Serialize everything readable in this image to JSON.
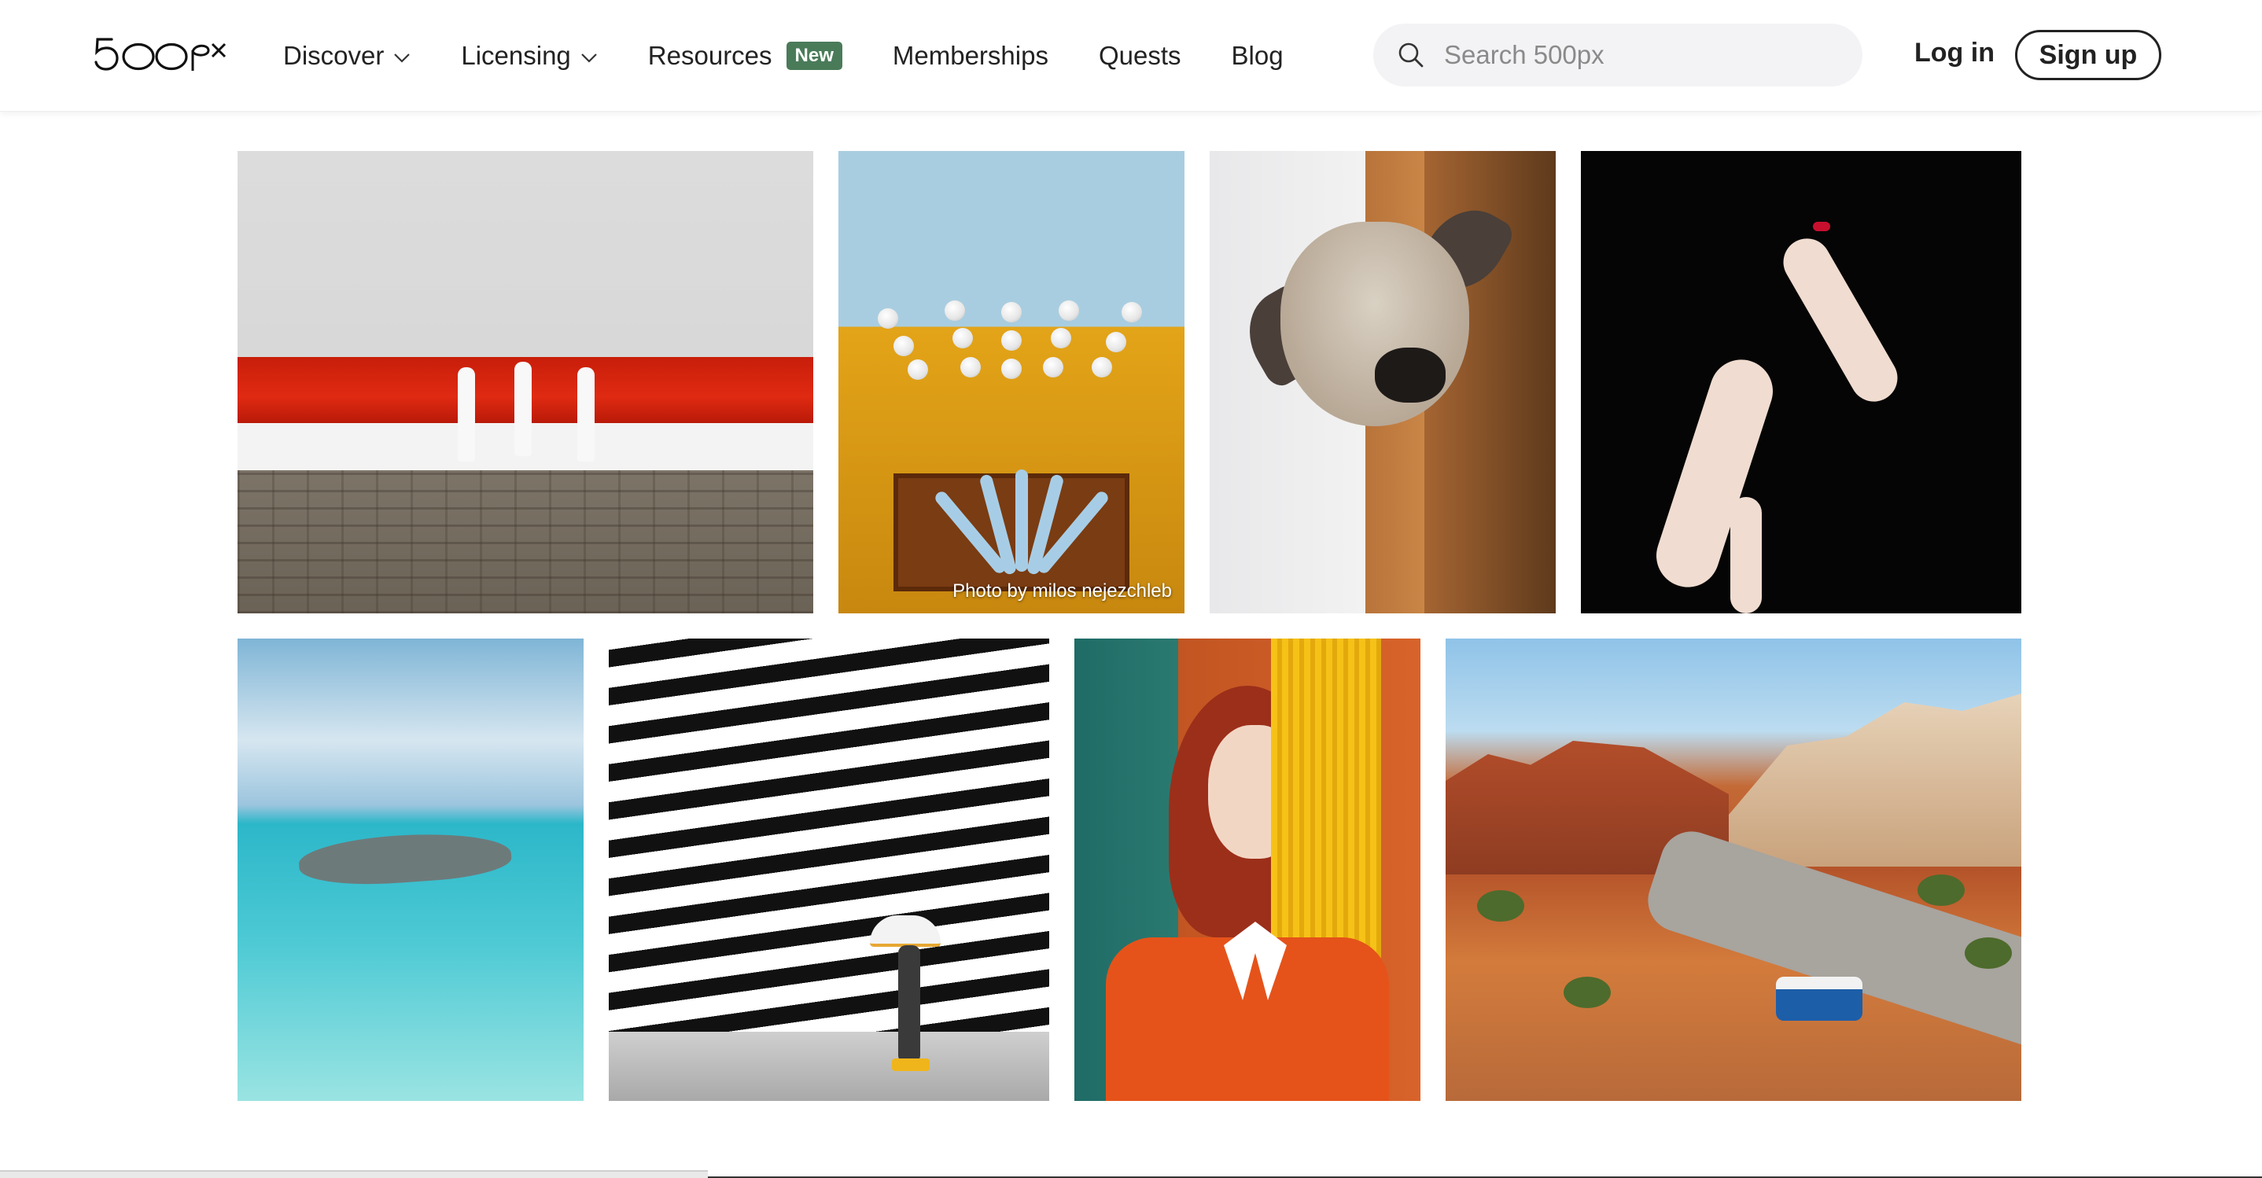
{
  "header": {
    "logo_text": "500px",
    "nav": [
      {
        "label": "Discover",
        "has_dropdown": true
      },
      {
        "label": "Licensing",
        "has_dropdown": true
      },
      {
        "label": "Resources",
        "badge": "New"
      },
      {
        "label": "Memberships"
      },
      {
        "label": "Quests"
      },
      {
        "label": "Blog"
      }
    ],
    "search": {
      "placeholder": "Search 500px",
      "icon": "search-icon"
    },
    "login_label": "Log in",
    "signup_label": "Sign up"
  },
  "photos": [
    {
      "subject": "men-walking-on-wall"
    },
    {
      "subject": "hanging-lamps",
      "credit": "Photo by milos nejezchleb"
    },
    {
      "subject": "dog-in-doorway"
    },
    {
      "subject": "woman-black-background"
    },
    {
      "subject": "shark-underwater"
    },
    {
      "subject": "striped-wall-umbrella"
    },
    {
      "subject": "red-haired-woman"
    },
    {
      "subject": "desert-road-car"
    }
  ],
  "colors": {
    "badge_green": "#4a7b59",
    "text": "#222222",
    "search_bg": "#f3f3f5"
  }
}
